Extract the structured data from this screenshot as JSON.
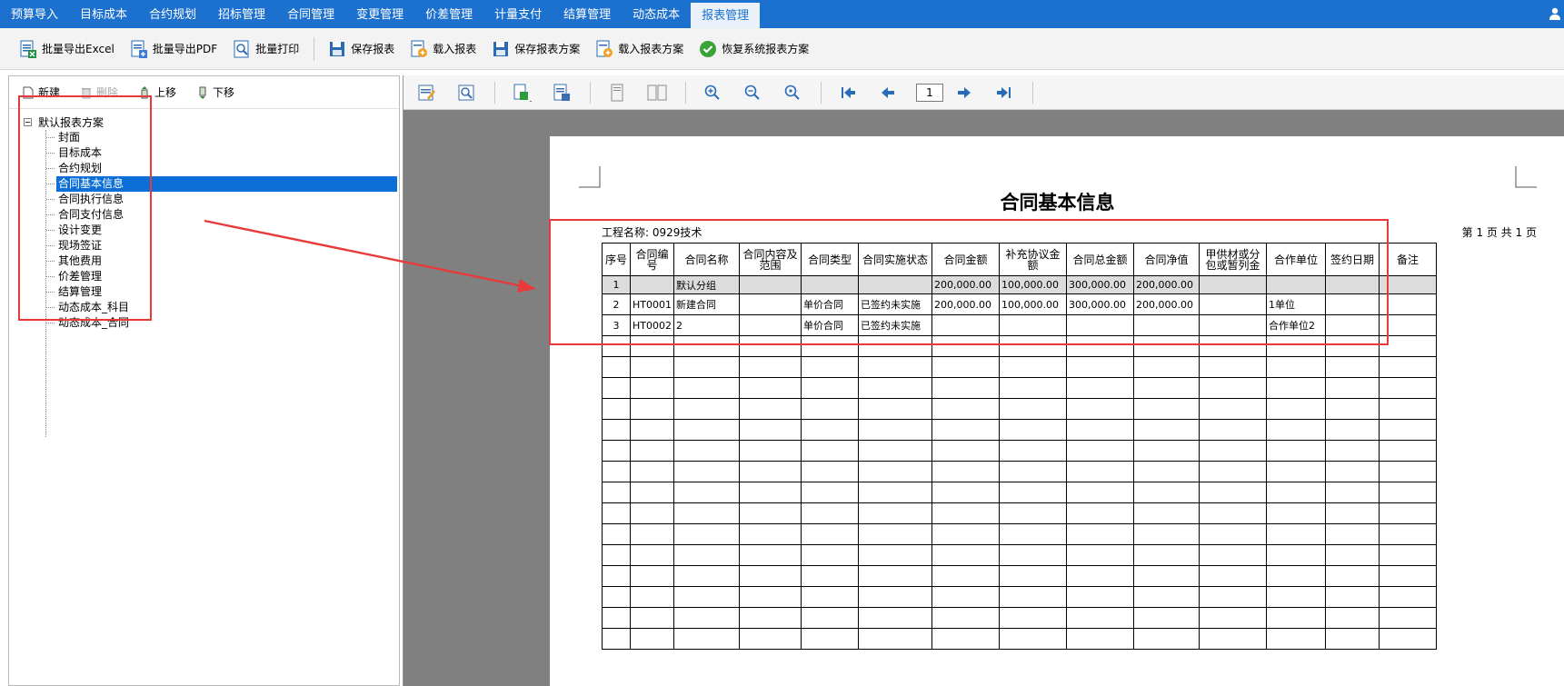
{
  "nav": {
    "tabs": [
      "预算导入",
      "目标成本",
      "合约规划",
      "招标管理",
      "合同管理",
      "变更管理",
      "价差管理",
      "计量支付",
      "结算管理",
      "动态成本",
      "报表管理"
    ],
    "active_index": 10
  },
  "toolbar": {
    "export_excel": "批量导出Excel",
    "export_pdf": "批量导出PDF",
    "batch_print": "批量打印",
    "save_report": "保存报表",
    "load_report": "载入报表",
    "save_scheme": "保存报表方案",
    "load_scheme": "载入报表方案",
    "restore_scheme": "恢复系统报表方案"
  },
  "left": {
    "new_label": "新建",
    "delete_label": "删除",
    "up_label": "上移",
    "down_label": "下移",
    "root_label": "默认报表方案",
    "items": [
      "封面",
      "目标成本",
      "合约规划",
      "合同基本信息",
      "合同执行信息",
      "合同支付信息",
      "设计变更",
      "现场签证",
      "其他费用",
      "价差管理",
      "结算管理",
      "动态成本_科目",
      "动态成本_合同"
    ],
    "selected_index": 3
  },
  "viewer": {
    "page_number": "1"
  },
  "report": {
    "title": "合同基本信息",
    "project_label": "工程名称: 0929技术",
    "page_info": "第 1 页  共 1 页",
    "columns": [
      "序号",
      "合同编号",
      "合同名称",
      "合同内容及范围",
      "合同类型",
      "合同实施状态",
      "合同金额",
      "补充协议金额",
      "合同总金额",
      "合同净值",
      "甲供材或分包或暂列金",
      "合作单位",
      "签约日期",
      "备注"
    ],
    "rows": [
      {
        "group": true,
        "cells": [
          "1",
          "",
          "默认分组",
          "",
          "",
          "",
          "200,000.00",
          "100,000.00",
          "300,000.00",
          "200,000.00",
          "",
          "",
          "",
          ""
        ]
      },
      {
        "group": false,
        "cells": [
          "2",
          "HT0001",
          "新建合同",
          "",
          "单价合同",
          "已签约未实施",
          "200,000.00",
          "100,000.00",
          "300,000.00",
          "200,000.00",
          "",
          "1单位",
          "",
          ""
        ]
      },
      {
        "group": false,
        "cells": [
          "3",
          "HT0002",
          "2",
          "",
          "单价合同",
          "已签约未实施",
          "",
          "",
          "",
          "",
          "",
          "合作单位2",
          "",
          ""
        ]
      }
    ]
  },
  "colors": {
    "nav_bg": "#1c70ce",
    "selected_bg": "#0b6fd7",
    "annotation_red": "#e83a3a"
  }
}
